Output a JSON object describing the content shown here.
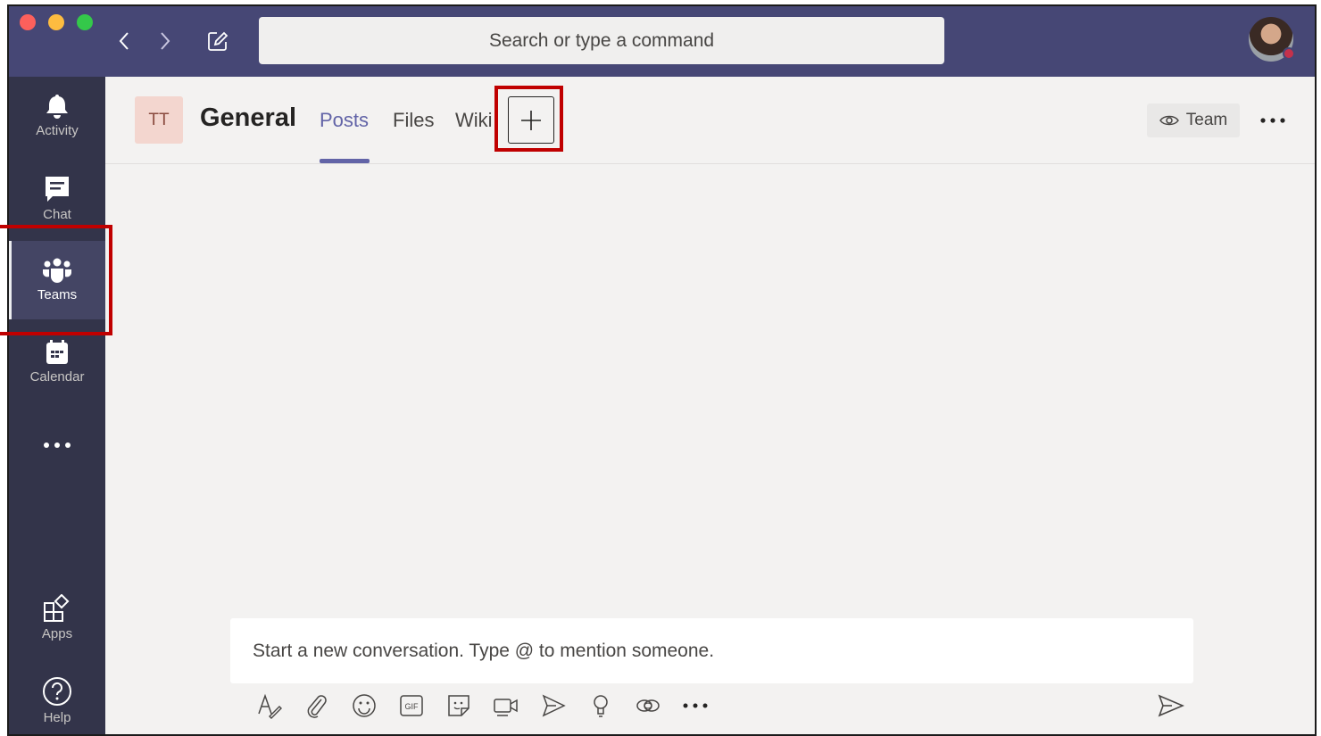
{
  "titlebar": {
    "search_placeholder": "Search or type a command",
    "back_icon": "chevron-left-icon",
    "forward_icon": "chevron-right-icon",
    "compose_icon": "new-chat-icon"
  },
  "rail": {
    "items": [
      {
        "label": "Activity",
        "icon": "bell-icon"
      },
      {
        "label": "Chat",
        "icon": "chat-icon"
      },
      {
        "label": "Teams",
        "icon": "teams-icon",
        "active": true
      },
      {
        "label": "Calendar",
        "icon": "calendar-icon"
      },
      {
        "label": "",
        "icon": "more-icon"
      },
      {
        "label": "Apps",
        "icon": "apps-icon"
      },
      {
        "label": "Help",
        "icon": "help-icon"
      }
    ]
  },
  "channel": {
    "team_initials": "TT",
    "title": "General",
    "tabs": [
      {
        "label": "Posts",
        "active": true
      },
      {
        "label": "Files"
      },
      {
        "label": "Wiki"
      }
    ],
    "team_button_label": "Team"
  },
  "compose": {
    "placeholder": "Start a new conversation. Type @ to mention someone.",
    "toolbar_icons": [
      "format-icon",
      "attach-icon",
      "emoji-icon",
      "gif-icon",
      "sticker-icon",
      "meet-now-icon",
      "praise-icon",
      "idea-icon",
      "loop-icon",
      "more-icon"
    ]
  },
  "colors": {
    "titlebar": "#464775",
    "rail": "#33344a",
    "accent": "#6264a7",
    "highlight": "#c00000"
  }
}
